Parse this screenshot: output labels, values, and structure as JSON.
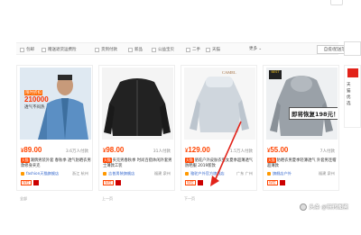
{
  "filters": [
    {
      "label": "包邮"
    },
    {
      "label": "赠送退货运费险"
    },
    {
      "label": "货到付款"
    },
    {
      "label": "新品"
    },
    {
      "label": "公益宝贝"
    },
    {
      "label": "二手"
    },
    {
      "label": "天猫"
    }
  ],
  "filter_more": "更多 ⌄",
  "place_button": "自提/配送范围",
  "products": [
    {
      "price": "89.00",
      "sales": "3.6万人付款",
      "tag": "天猫",
      "title": "潮牌男装外套 春秋季 透气防晒衣男款修身夹克",
      "shop": "fashion天猫旗舰店",
      "location": "浙江 杭州",
      "promo_label": "限时折扣",
      "promo_number": "210000",
      "promo_sub": "透气不闷热"
    },
    {
      "price": "98.00",
      "sales": "31人付款",
      "tag": "天猫",
      "title": "夹克男春秋季 时尚百搭休闲外套男士薄款工装",
      "shop": "吉普男装旗舰店",
      "location": "福建 泉州"
    },
    {
      "price": "129.00",
      "sales": "1.5万人付款",
      "tag": "天猫",
      "title": "骆驼户外皮肤衣男女夏季超薄透气防晒服 2019新款",
      "shop": "骆驼户外官方旗舰店",
      "location": "广东 广州",
      "brand": "CAMEL"
    },
    {
      "price": "55.00",
      "sales": "7人付款",
      "tag": "天猫",
      "title": "防晒衣男夏季轻薄透气 外套男连帽超薄款",
      "shop": "旗舰店户外",
      "location": "福建 泉州",
      "banner": "即将恢复198元！",
      "logo": "BEST"
    }
  ],
  "bottom_items": [
    "全部",
    "上一页",
    "下一页"
  ],
  "side_ad": [
    "天",
    "猫",
    "优",
    "选"
  ],
  "watermark": "头条 @玩转图鉴",
  "colors": {
    "price": "#ff4400",
    "tmall_tag": "#ff4400",
    "shop_link": "#3366cc"
  }
}
